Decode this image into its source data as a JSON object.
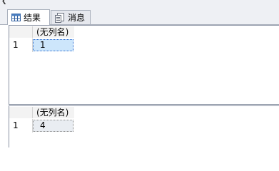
{
  "tabs": {
    "results_label": "结果",
    "messages_label": "消息",
    "results_icon": "grid-icon",
    "messages_icon": "message-icon"
  },
  "result_grids": [
    {
      "column_header": "(无列名)",
      "row_number": "1",
      "value": "1",
      "selected": true
    },
    {
      "column_header": "(无列名)",
      "row_number": "1",
      "value": "4",
      "selected": false
    }
  ],
  "colors": {
    "selected_cell": "#cde6fb",
    "selection_border": "#2a6bd1",
    "panel_border": "#8a93a3"
  }
}
